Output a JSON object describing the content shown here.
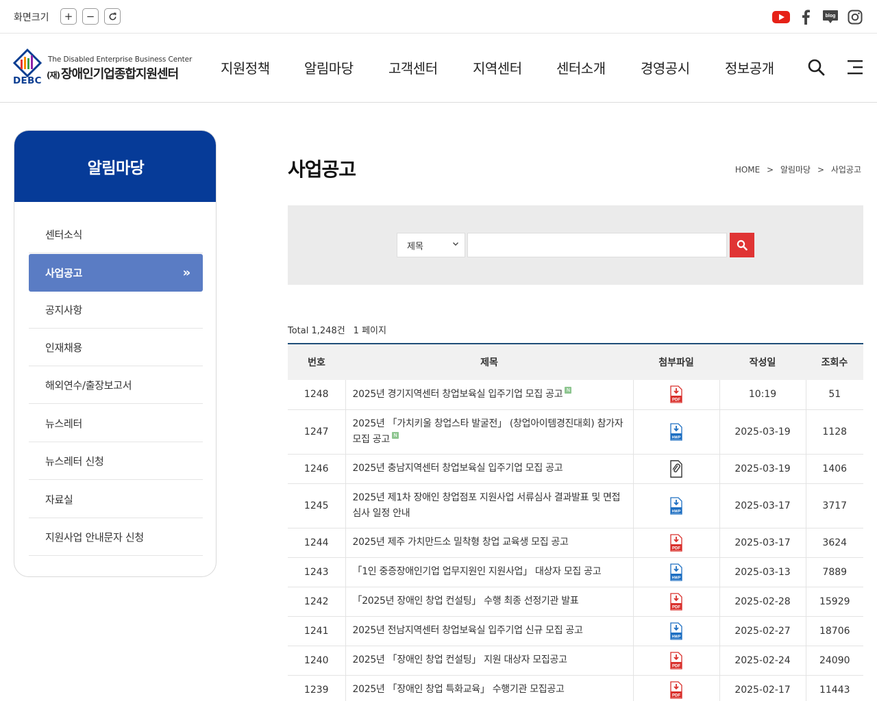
{
  "utility": {
    "zoom_label": "화면크기",
    "zoom_in": "+",
    "zoom_out": "−",
    "zoom_reset": "↻",
    "social_icons": [
      "youtube-icon",
      "facebook-icon",
      "blog-icon",
      "instagram-icon"
    ],
    "blog_text": "blog"
  },
  "logo": {
    "english": "The Disabled Enterprise Business Center",
    "prefix": "(재)",
    "korean": "장애인기업종합지원센터",
    "abbr": "DEBC"
  },
  "nav": [
    "지원정책",
    "알림마당",
    "고객센터",
    "지역센터",
    "센터소개",
    "경영공시",
    "정보공개"
  ],
  "sidebar": {
    "title": "알림마당",
    "items": [
      "센터소식",
      "사업공고",
      "공지사항",
      "인재채용",
      "해외연수/출장보고서",
      "뉴스레터",
      "뉴스레터 신청",
      "자료실",
      "지원사업 안내문자 신청"
    ],
    "active_index": 1,
    "active_arrow": "»"
  },
  "page": {
    "title": "사업공고",
    "breadcrumb": [
      "HOME",
      "알림마당",
      "사업공고"
    ],
    "breadcrumb_sep": ">"
  },
  "search": {
    "field_selected": "제목",
    "input_value": ""
  },
  "summary": {
    "total": "Total 1,248건",
    "page": "1 페이지"
  },
  "table": {
    "headers": [
      "번호",
      "제목",
      "첨부파일",
      "작성일",
      "조회수"
    ],
    "new_badge": "N",
    "rows": [
      {
        "no": "1248",
        "title": "2025년 경기지역센터 창업보육실 입주기업 모집 공고",
        "new": true,
        "file": "pdf",
        "date": "10:19",
        "views": "51"
      },
      {
        "no": "1247",
        "title": "2025년 「가치키울 창업스타 발굴전」 (창업아이템경진대회) 참가자 모집 공고",
        "new": true,
        "file": "hwp",
        "date": "2025-03-19",
        "views": "1128"
      },
      {
        "no": "1246",
        "title": "2025년 충남지역센터 창업보육실 입주기업 모집 공고",
        "new": false,
        "file": "clip",
        "date": "2025-03-19",
        "views": "1406"
      },
      {
        "no": "1245",
        "title": "2025년 제1차 장애인 창업점포 지원사업 서류심사 결과발표 및 면접심사 일정 안내",
        "new": false,
        "file": "hwp",
        "date": "2025-03-17",
        "views": "3717"
      },
      {
        "no": "1244",
        "title": "2025년 제주 가치만드소 밀착형 창업 교육생 모집 공고",
        "new": false,
        "file": "pdf",
        "date": "2025-03-17",
        "views": "3624"
      },
      {
        "no": "1243",
        "title": "「1인 중증장애인기업 업무지원인 지원사업」 대상자 모집 공고",
        "new": false,
        "file": "hwp",
        "date": "2025-03-13",
        "views": "7889"
      },
      {
        "no": "1242",
        "title": "「2025년 장애인 창업 컨설팅」 수행 최종 선정기관 발표",
        "new": false,
        "file": "pdf",
        "date": "2025-02-28",
        "views": "15929"
      },
      {
        "no": "1241",
        "title": "2025년 전남지역센터 창업보육실 입주기업 신규 모집 공고",
        "new": false,
        "file": "hwp",
        "date": "2025-02-27",
        "views": "18706"
      },
      {
        "no": "1240",
        "title": "2025년 「장애인 창업 컨설팅」 지원 대상자 모집공고",
        "new": false,
        "file": "pdf",
        "date": "2025-02-24",
        "views": "24090"
      },
      {
        "no": "1239",
        "title": "2025년 「장애인 창업 특화교육」 수행기관 모집공고",
        "new": false,
        "file": "pdf",
        "date": "2025-02-17",
        "views": "11443"
      }
    ]
  },
  "colors": {
    "brand_navy": "#063b98",
    "sidebar_active": "#5a7cc4",
    "search_button": "#e03434",
    "table_top_border": "#1f4e79",
    "pdf_red": "#d9302c",
    "hwp_blue": "#1e6fc2"
  }
}
